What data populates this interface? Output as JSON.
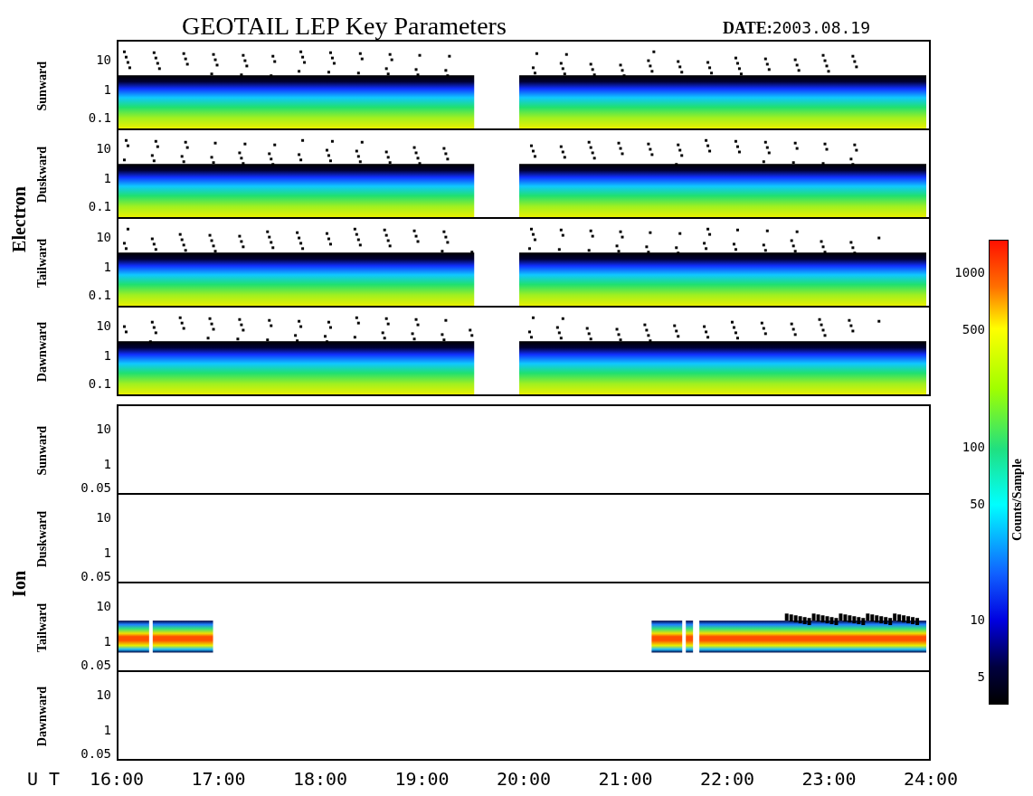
{
  "title": "GEOTAIL LEP Key Parameters",
  "date": "**DATE:**2003.08.19",
  "groups": [
    {
      "name": "Electron",
      "panels": [
        {
          "label": "Sunward",
          "kind": "electron",
          "yticks": [
            "10",
            "1",
            "0.1"
          ]
        },
        {
          "label": "Duskward",
          "kind": "electron",
          "yticks": [
            "10",
            "1",
            "0.1"
          ]
        },
        {
          "label": "Tailward",
          "kind": "electron",
          "yticks": [
            "10",
            "1",
            "0.1"
          ]
        },
        {
          "label": "Dawnward",
          "kind": "electron",
          "yticks": [
            "10",
            "1",
            "0.1"
          ]
        }
      ]
    },
    {
      "name": "Ion",
      "panels": [
        {
          "label": "Sunward",
          "kind": "empty",
          "yticks": [
            "10",
            "1",
            "0.05"
          ]
        },
        {
          "label": "Duskward",
          "kind": "empty",
          "yticks": [
            "10",
            "1",
            "0.05"
          ]
        },
        {
          "label": "Tailward",
          "kind": "ion",
          "yticks": [
            "10",
            "1",
            "0.05"
          ]
        },
        {
          "label": "Dawnward",
          "kind": "empty",
          "yticks": [
            "10",
            "1",
            "0.05"
          ]
        }
      ]
    }
  ],
  "colorbar": {
    "label": "Counts/Sample",
    "ticks": [
      "1000",
      "500",
      "100",
      "50",
      "10",
      "5"
    ]
  },
  "x_axis": {
    "label": "U T",
    "ticks": [
      "16:00",
      "17:00",
      "18:00",
      "19:00",
      "20:00",
      "21:00",
      "22:00",
      "23:00",
      "24:00"
    ]
  }
}
